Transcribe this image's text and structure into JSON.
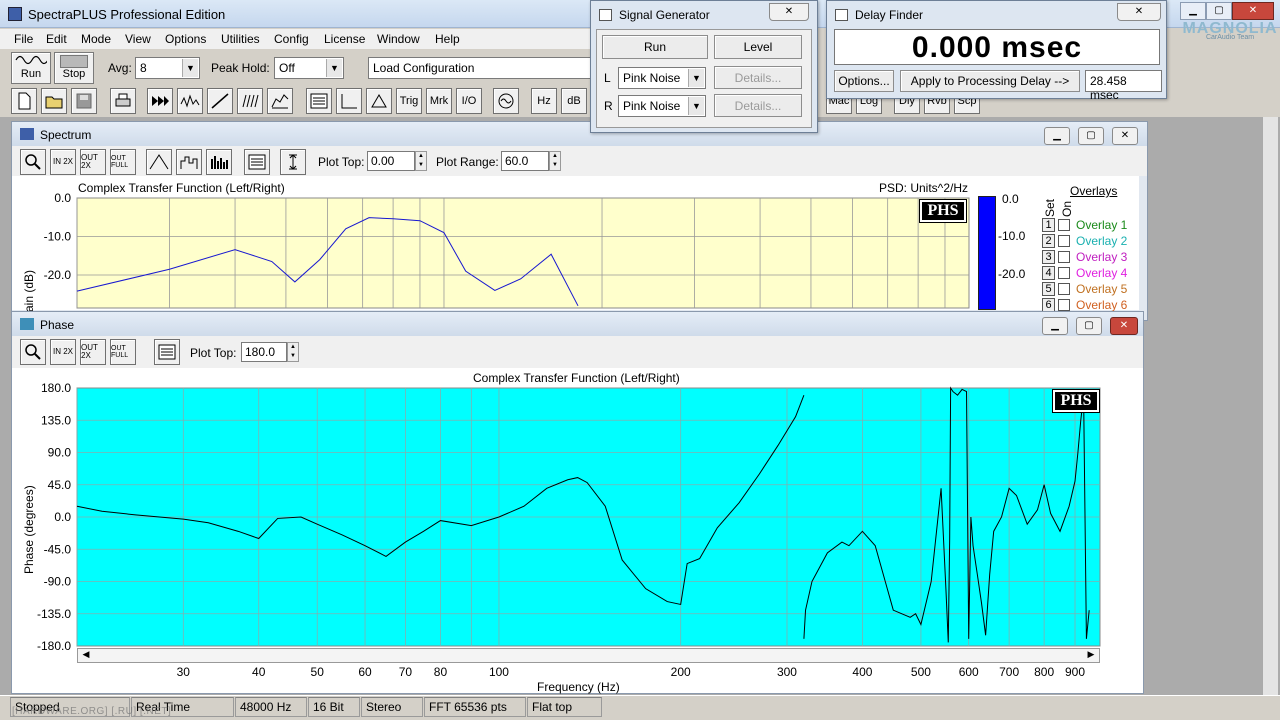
{
  "app": {
    "title": "SpectraPLUS Professional Edition",
    "menu": [
      "File",
      "Edit",
      "Mode",
      "View",
      "Options",
      "Utilities",
      "Config",
      "License",
      "Window",
      "Help"
    ],
    "minimize_glyph": "▁",
    "maximize_glyph": "▢",
    "close_glyph": "✕"
  },
  "toolbar": {
    "run_label": "Run",
    "stop_label": "Stop",
    "avg_label": "Avg:",
    "avg_value": "8",
    "peak_hold_label": "Peak Hold:",
    "peak_hold_value": "Off",
    "load_config_value": "Load Configuration",
    "icon_row": [
      "new",
      "open",
      "save",
      "print",
      "fwd",
      "fwd-ff",
      "wave",
      "ramp",
      "stack",
      "spectro",
      "spectrum",
      "meter",
      "scope",
      "Trig",
      "Mrk",
      "I/O",
      "gen",
      "Hz",
      "dB"
    ],
    "right_buttons": [
      "Mac",
      "Log",
      "Dly",
      "Rvb",
      "Scp"
    ]
  },
  "signal_generator": {
    "title": "Signal Generator",
    "run_label": "Run",
    "level_label": "Level",
    "left_channel": "L",
    "right_channel": "R",
    "left_signal": "Pink Noise",
    "right_signal": "Pink Noise",
    "details_label": "Details..."
  },
  "delay_finder": {
    "title": "Delay Finder",
    "readout": "0.000 msec",
    "options_label": "Options...",
    "apply_label": "Apply to Processing Delay -->",
    "delay_value": "28.458 msec"
  },
  "watermark": {
    "line1": "MAGNOLIA",
    "line2": "CarAudio Team"
  },
  "spectrum": {
    "title": "Spectrum",
    "plot_top_label": "Plot Top:",
    "plot_top_value": "0.00",
    "plot_range_label": "Plot Range:",
    "plot_range_value": "60.0",
    "chart_title": "Complex Transfer Function (Left/Right)",
    "psd_label": "PSD: Units^2/Hz",
    "phs_badge": "PHS",
    "y_axis_label": "ain (dB)",
    "y_ticks": [
      "0.0",
      "-10.0",
      "-20.0"
    ],
    "meter_ticks": [
      "0.0",
      "-10.0",
      "-20.0"
    ],
    "overlays_header": "Overlays",
    "set_label": "Set",
    "on_label": "On",
    "overlays": [
      {
        "num": "1",
        "name": "Overlay 1",
        "color": "#1a8a1a"
      },
      {
        "num": "2",
        "name": "Overlay 2",
        "color": "#1ab0b0"
      },
      {
        "num": "3",
        "name": "Overlay 3",
        "color": "#c020c0"
      },
      {
        "num": "4",
        "name": "Overlay 4",
        "color": "#e020e0"
      },
      {
        "num": "5",
        "name": "Overlay 5",
        "color": "#c07020"
      },
      {
        "num": "6",
        "name": "Overlay 6",
        "color": "#d06020"
      }
    ],
    "zoom_buttons": [
      "zoom",
      "IN 2X",
      "OUT 2X",
      "OUT FULL",
      "peak",
      "bars",
      "histogram",
      "table",
      "scale"
    ]
  },
  "phase": {
    "title": "Phase",
    "plot_top_label": "Plot Top:",
    "plot_top_value": "180.0",
    "chart_title": "Complex Transfer Function (Left/Right)",
    "phs_badge": "PHS",
    "y_axis_label": "Phase (degrees)",
    "x_axis_label": "Frequency (Hz)",
    "zoom_buttons": [
      "zoom",
      "IN 2X",
      "OUT 2X",
      "OUT FULL",
      "table"
    ]
  },
  "chart_data": [
    {
      "type": "line",
      "title": "Complex Transfer Function (Left/Right)",
      "ylabel": "Gain (dB)",
      "ylim": [
        -60,
        0
      ],
      "x_scale": "log",
      "series": [
        {
          "values_x": [
            20,
            30,
            40,
            47,
            52,
            58,
            65,
            72,
            80,
            90,
            100,
            110,
            125,
            140,
            160,
            180
          ],
          "values_y": [
            -24.2,
            -18.5,
            -13.4,
            -16.5,
            -21.8,
            -16,
            -8,
            -5.1,
            -5.4,
            -5.9,
            -9,
            -19,
            -24,
            -21,
            -14.6,
            -28
          ]
        }
      ],
      "color": "#1818d0"
    },
    {
      "type": "line",
      "title": "Complex Transfer Function (Left/Right)",
      "xlabel": "Frequency (Hz)",
      "ylabel": "Phase (degrees)",
      "ylim": [
        -180,
        180
      ],
      "x_scale": "log",
      "x_ticks": [
        30,
        40,
        50,
        60,
        70,
        80,
        100,
        200,
        300,
        400,
        500,
        600,
        700,
        800,
        900
      ],
      "y_ticks": [
        "180.0",
        "135.0",
        "90.0",
        "45.0",
        "0.0",
        "-45.0",
        "-90.0",
        "-135.0",
        "-180.0"
      ],
      "color": "#000000",
      "series": [
        {
          "x": [
            20,
            22,
            25,
            30,
            33,
            37,
            40,
            43,
            47,
            50,
            55,
            60,
            65,
            70,
            75,
            80,
            90,
            100,
            110,
            120,
            130,
            135,
            140,
            150,
            160,
            175,
            190,
            200,
            205,
            215,
            230,
            250,
            270,
            290,
            310,
            320
          ],
          "y": [
            15,
            8,
            3,
            -3,
            -8,
            -20,
            -30,
            -2,
            0,
            -10,
            -25,
            -40,
            -55,
            -35,
            -20,
            -5,
            -12,
            0,
            15,
            40,
            52,
            55,
            48,
            15,
            -60,
            -100,
            -118,
            -122,
            -65,
            -58,
            -15,
            20,
            60,
            100,
            140,
            170
          ]
        },
        {
          "x": [
            320,
            322,
            330,
            350,
            370,
            380,
            400,
            420,
            450,
            480,
            490,
            500,
            520,
            540,
            550,
            555,
            558,
            560,
            565,
            575,
            585,
            595,
            600,
            605,
            610,
            620,
            630,
            640,
            650,
            660,
            680,
            700,
            720,
            750,
            780,
            800,
            820,
            850,
            880,
            900,
            910,
            920,
            930,
            940,
            950
          ],
          "y": [
            -170,
            -130,
            -90,
            -50,
            -35,
            -40,
            -20,
            -40,
            -130,
            -140,
            -135,
            -150,
            -90,
            40,
            -100,
            -175,
            -30,
            180,
            175,
            170,
            178,
            175,
            -170,
            0,
            -40,
            -80,
            -120,
            -165,
            -80,
            -20,
            0,
            40,
            30,
            -10,
            10,
            45,
            5,
            -20,
            15,
            50,
            90,
            135,
            170,
            -170,
            -130
          ]
        }
      ]
    }
  ],
  "status": {
    "state": "Stopped",
    "mode": "Real Time",
    "rate": "48000 Hz",
    "bits": "16 Bit",
    "channels": "Stereo",
    "fft": "FFT 65536 pts",
    "window": "Flat top",
    "footer_text": "[HARDWARE.ORG] [.RU] [.NET]"
  }
}
